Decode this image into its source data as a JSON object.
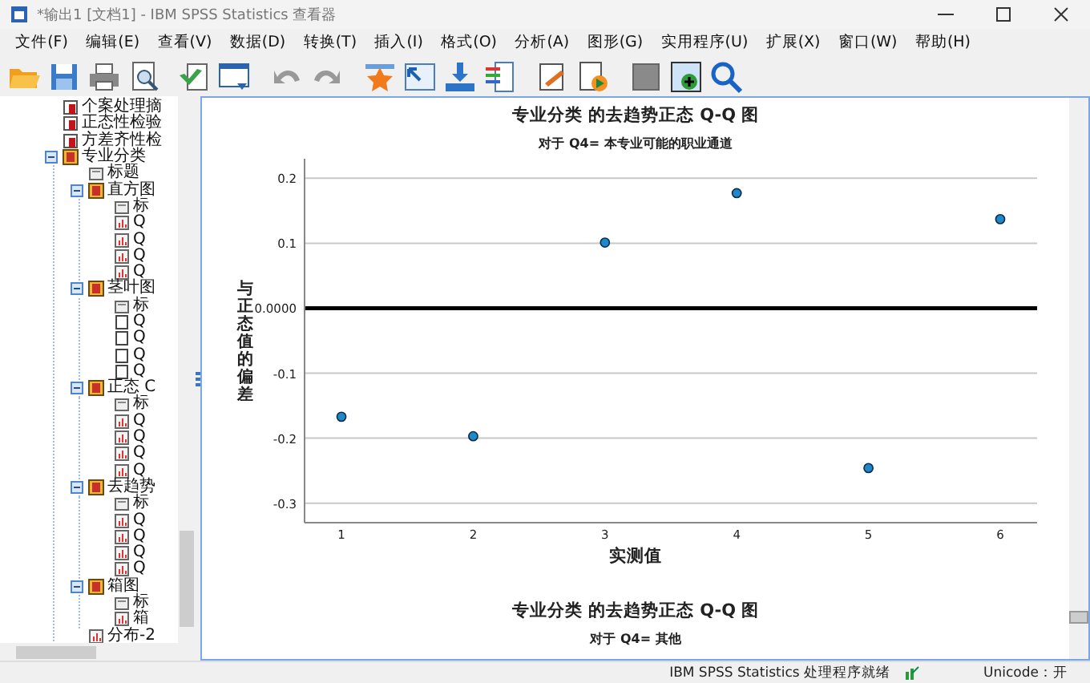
{
  "window": {
    "title": "*输出1 [文档1] - IBM SPSS Statistics 查看器"
  },
  "menu": [
    "文件(F)",
    "编辑(E)",
    "查看(V)",
    "数据(D)",
    "转换(T)",
    "插入(I)",
    "格式(O)",
    "分析(A)",
    "图形(G)",
    "实用程序(U)",
    "扩展(X)",
    "窗口(W)",
    "帮助(H)"
  ],
  "outline": {
    "items": [
      {
        "label": "个案处理摘",
        "kind": "table"
      },
      {
        "label": "正态性检验",
        "kind": "table"
      },
      {
        "label": "方差齐性检",
        "kind": "table"
      },
      {
        "label": "专业分类",
        "kind": "group",
        "expanded": true,
        "children": [
          {
            "label": "标题",
            "kind": "heading"
          },
          {
            "label": "直方图",
            "kind": "group",
            "expanded": true,
            "children": [
              {
                "label": "标",
                "kind": "heading"
              },
              {
                "label": "Q",
                "kind": "chart"
              },
              {
                "label": "Q",
                "kind": "chart"
              },
              {
                "label": "Q",
                "kind": "chart"
              },
              {
                "label": "Q",
                "kind": "chart"
              }
            ]
          },
          {
            "label": "茎叶图",
            "kind": "group",
            "expanded": true,
            "children": [
              {
                "label": "标",
                "kind": "heading"
              },
              {
                "label": "Q",
                "kind": "page"
              },
              {
                "label": "Q",
                "kind": "page"
              },
              {
                "label": "Q",
                "kind": "page"
              },
              {
                "label": "Q",
                "kind": "page"
              }
            ]
          },
          {
            "label": "正态 C",
            "kind": "group",
            "expanded": true,
            "children": [
              {
                "label": "标",
                "kind": "heading"
              },
              {
                "label": "Q",
                "kind": "chart"
              },
              {
                "label": "Q",
                "kind": "chart"
              },
              {
                "label": "Q",
                "kind": "chart"
              },
              {
                "label": "Q",
                "kind": "chart"
              }
            ]
          },
          {
            "label": "去趋势",
            "kind": "group",
            "expanded": true,
            "children": [
              {
                "label": "标",
                "kind": "heading"
              },
              {
                "label": "Q",
                "kind": "chart"
              },
              {
                "label": "Q",
                "kind": "chart"
              },
              {
                "label": "Q",
                "kind": "chart"
              },
              {
                "label": "Q",
                "kind": "chart"
              }
            ]
          },
          {
            "label": "箱图",
            "kind": "group",
            "expanded": true,
            "children": [
              {
                "label": "标",
                "kind": "heading"
              },
              {
                "label": "箱",
                "kind": "chart"
              }
            ]
          },
          {
            "label": "分布-2",
            "kind": "chart"
          }
        ]
      }
    ]
  },
  "output": {
    "title": "专业分类 的去趋势正态 Q-Q 图",
    "subtitle": "对于 Q4= 本专业可能的职业通道",
    "chart_data": {
      "type": "scatter",
      "grid": true,
      "xlabel": "实测值",
      "ylabel": "与正态值的偏差",
      "x": [
        1,
        2,
        3,
        4,
        5,
        6
      ],
      "series": [
        {
          "color": "#1e88c9",
          "values": [
            -0.167,
            -0.197,
            0.101,
            0.177,
            -0.246,
            0.137
          ]
        }
      ],
      "xlim": [
        0.72,
        6.28
      ],
      "ylim": [
        -0.33,
        0.23
      ],
      "xticks": [
        1,
        2,
        3,
        4,
        5,
        6
      ],
      "yticks": [
        {
          "value": 0.2,
          "label": "0.2"
        },
        {
          "value": 0.1,
          "label": "0.1"
        },
        {
          "value": 0,
          "label": "0.0000"
        },
        {
          "value": -0.1,
          "label": "-0.1"
        },
        {
          "value": -0.2,
          "label": "-0.2"
        },
        {
          "value": -0.3,
          "label": "-0.3"
        }
      ]
    },
    "next_title": "专业分类 的去趋势正态 Q-Q 图",
    "next_subtitle": "对于 Q4= 其他"
  },
  "status_bar": {
    "message": "IBM SPSS Statistics 处理程序就绪",
    "encoding": "Unicode：开"
  }
}
